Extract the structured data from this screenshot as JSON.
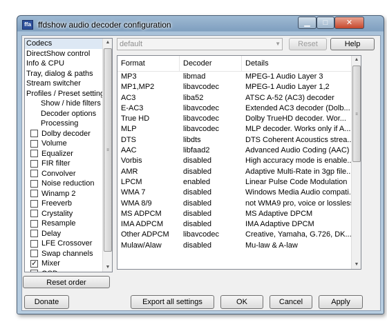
{
  "window": {
    "title": "ffdshow audio decoder configuration",
    "icon_label": "ffa",
    "min_glyph": "▁",
    "max_glyph": "□",
    "close_glyph": "✕"
  },
  "tree": {
    "items": [
      {
        "label": "Codecs",
        "level": 0,
        "selected": true
      },
      {
        "label": "DirectShow control",
        "level": 0
      },
      {
        "label": "Info & CPU",
        "level": 0
      },
      {
        "label": "Tray, dialog & paths",
        "level": 0
      },
      {
        "label": "Stream switcher",
        "level": 0
      },
      {
        "label": "Profiles / Preset settings",
        "level": 0
      },
      {
        "label": "Show / hide filters",
        "level": 1
      },
      {
        "label": "Decoder options",
        "level": 1
      },
      {
        "label": "Processing",
        "level": 1
      },
      {
        "label": "Dolby decoder",
        "checkbox": true,
        "checked": false
      },
      {
        "label": "Volume",
        "checkbox": true,
        "checked": false
      },
      {
        "label": "Equalizer",
        "checkbox": true,
        "checked": false
      },
      {
        "label": "FIR filter",
        "checkbox": true,
        "checked": false
      },
      {
        "label": "Convolver",
        "checkbox": true,
        "checked": false
      },
      {
        "label": "Noise reduction",
        "checkbox": true,
        "checked": false
      },
      {
        "label": "Winamp 2",
        "checkbox": true,
        "checked": false
      },
      {
        "label": "Freeverb",
        "checkbox": true,
        "checked": false
      },
      {
        "label": "Crystality",
        "checkbox": true,
        "checked": false
      },
      {
        "label": "Resample",
        "checkbox": true,
        "checked": false
      },
      {
        "label": "Delay",
        "checkbox": true,
        "checked": false
      },
      {
        "label": "LFE Crossover",
        "checkbox": true,
        "checked": false
      },
      {
        "label": "Swap channels",
        "checkbox": true,
        "checked": false
      },
      {
        "label": "Mixer",
        "checkbox": true,
        "checked": true
      },
      {
        "label": "OSD",
        "checkbox": true,
        "checked": false
      }
    ],
    "scroll_grip": "≡"
  },
  "reset_order_label": "Reset order",
  "preset": {
    "value": "default",
    "reset_label": "Reset",
    "help_label": "Help"
  },
  "codecs": {
    "columns": [
      "Format",
      "Decoder",
      "Details"
    ],
    "rows": [
      [
        "MP3",
        "libmad",
        "MPEG-1 Audio Layer 3"
      ],
      [
        "MP1,MP2",
        "libavcodec",
        "MPEG-1 Audio Layer 1,2"
      ],
      [
        "AC3",
        "liba52",
        "ATSC A-52 (AC3) decoder"
      ],
      [
        "E-AC3",
        "libavcodec",
        "Extended AC3 decoder (Dolb..."
      ],
      [
        "True HD",
        "libavcodec",
        "Dolby TrueHD decoder. Wor..."
      ],
      [
        "MLP",
        "libavcodec",
        "MLP decoder. Works only if A..."
      ],
      [
        "DTS",
        "libdts",
        "DTS Coherent Acoustics strea..."
      ],
      [
        "AAC",
        "libfaad2",
        "Advanced Audio Coding (AAC)"
      ],
      [
        "Vorbis",
        "disabled",
        "High accuracy mode is enable..."
      ],
      [
        "AMR",
        "disabled",
        "Adaptive Multi-Rate in 3gp file..."
      ],
      [
        "LPCM",
        "enabled",
        "Linear Pulse Code Modulation"
      ],
      [
        "WMA 7",
        "disabled",
        "Windows Media Audio compati..."
      ],
      [
        "WMA 8/9",
        "disabled",
        "not WMA9 pro, voice or lossless"
      ],
      [
        "MS ADPCM",
        "disabled",
        "MS Adaptive DPCM"
      ],
      [
        "IMA ADPCM",
        "disabled",
        "IMA Adaptive DPCM"
      ],
      [
        "Other ADPCM",
        "libavcodec",
        "Creative, Yamaha, G.726, DK..."
      ],
      [
        "Mulaw/Alaw",
        "disabled",
        "Mu-law & A-law"
      ]
    ],
    "scroll_grip": "≡"
  },
  "footer": {
    "donate_label": "Donate",
    "export_label": "Export all settings",
    "ok_label": "OK",
    "cancel_label": "Cancel",
    "apply_label": "Apply"
  },
  "scroll_arrows": {
    "up": "▲",
    "down": "▼"
  }
}
